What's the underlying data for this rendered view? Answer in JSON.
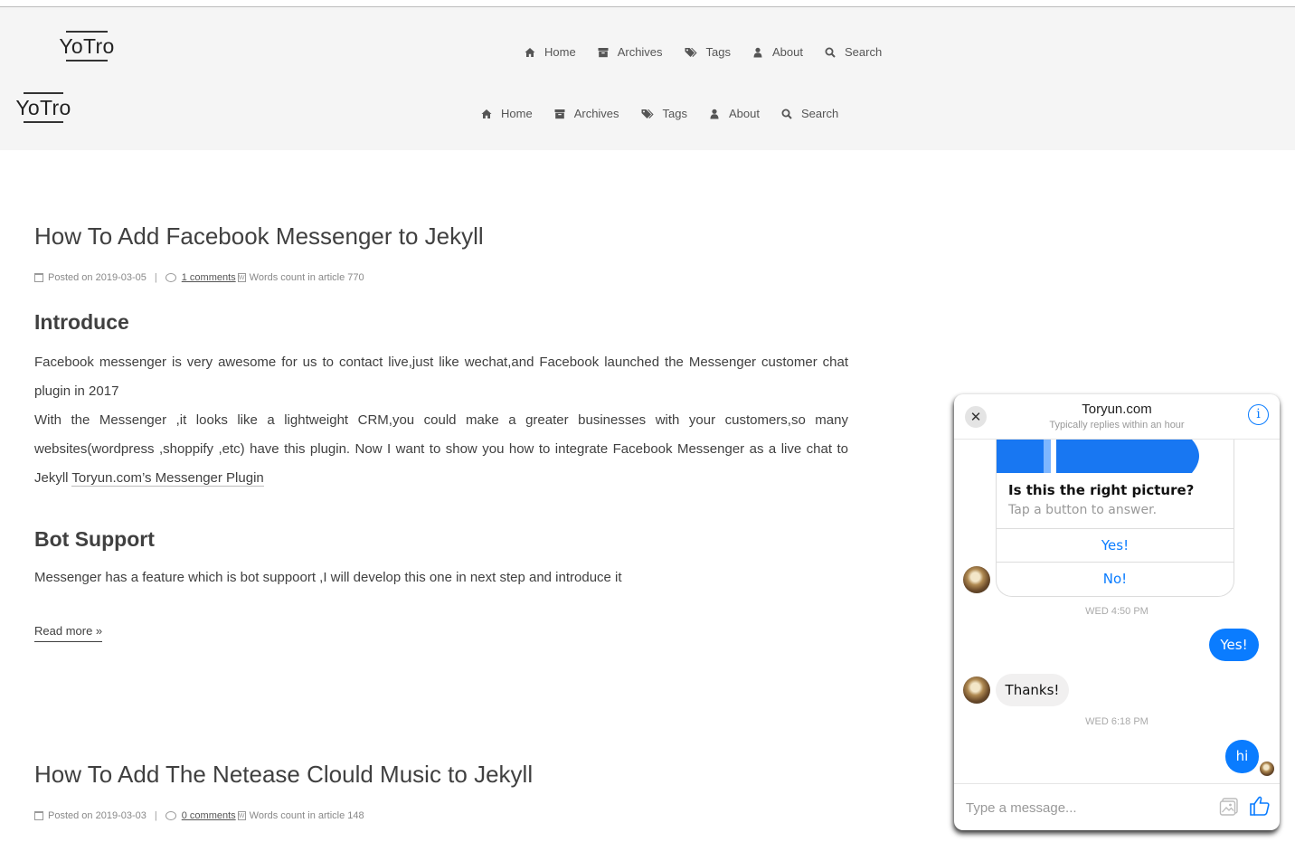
{
  "header": {
    "logo": "YoTro",
    "nav": [
      {
        "label": "Home",
        "icon": "home-icon"
      },
      {
        "label": "Archives",
        "icon": "archive-icon"
      },
      {
        "label": "Tags",
        "icon": "tags-icon"
      },
      {
        "label": "About",
        "icon": "user-icon"
      },
      {
        "label": "Search",
        "icon": "search-icon"
      }
    ]
  },
  "posts": [
    {
      "title": "How To Add Facebook Messenger to Jekyll",
      "posted": "Posted on 2019-03-05",
      "comments": "1 comments",
      "words": "Words count in article 770",
      "sections": [
        {
          "heading": "Introduce"
        },
        {
          "heading": "Bot Support"
        }
      ],
      "intro_p1": "Facebook messenger is very awesome for us to contact live,just like wechat,and Facebook launched the Messenger customer chat plugin in 2017",
      "intro_p2": "With the Messenger ,it looks like a lightweight CRM,you could make a greater businesses with your customers,so many websites(wordpress ,shoppify ,etc) have this plugin. Now I want to show you how to integrate Facebook Messenger as a live chat to Jekyll",
      "intro_link": "Toryun.com’s Messenger Plugin",
      "bot_p": "Messenger has a feature which is bot suppoort ,I will develop this one in next step and introduce it",
      "read_more": "Read more »"
    },
    {
      "title": "How To Add The Netease Clould Music to Jekyll",
      "posted": "Posted on 2019-03-03",
      "comments": "0 comments",
      "words": "Words count in article 148"
    }
  ],
  "messenger": {
    "page_name": "Toryun.com",
    "reply_time": "Typically replies within an hour",
    "question": "Is this the right picture?",
    "hint": "Tap a button to answer.",
    "btn_yes": "Yes!",
    "btn_no": "No!",
    "time1": "WED 4:50 PM",
    "out1": "Yes!",
    "in1": "Thanks!",
    "time2": "WED 6:18 PM",
    "out2": "hi",
    "placeholder": "Type a message...",
    "accent_color": "#0a7cff"
  }
}
